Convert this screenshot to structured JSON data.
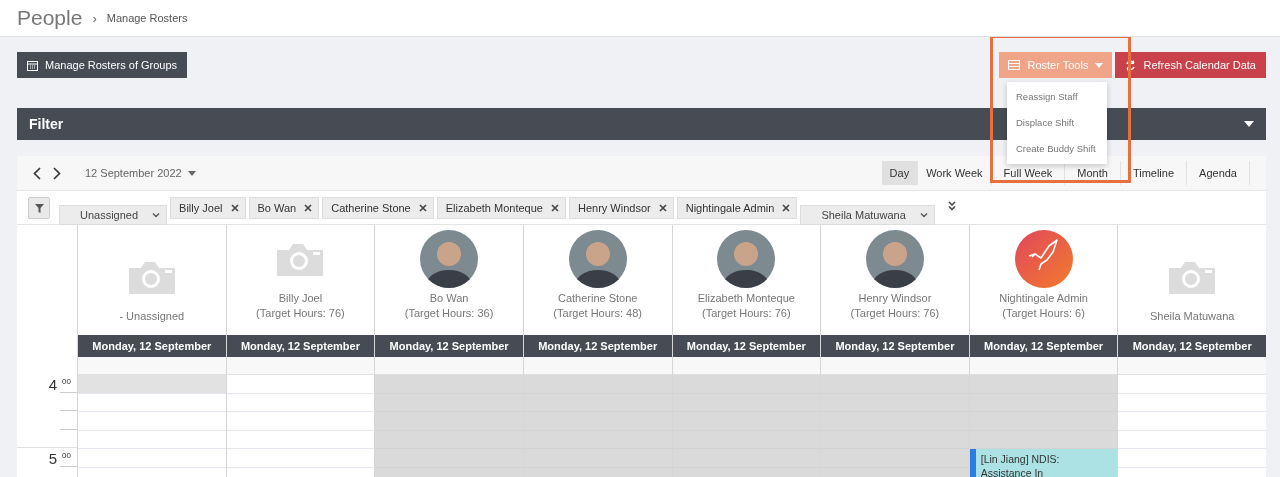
{
  "breadcrumb": {
    "title": "People",
    "separator": "›",
    "current": "Manage Rosters"
  },
  "buttons": [
    {
      "label": "Manage Rosters of Groups",
      "kind": "dark"
    },
    {
      "label": "Roster Tools",
      "kind": "tools",
      "expanded": true
    },
    {
      "label": "Refresh Calendar Data",
      "kind": "danger"
    }
  ],
  "roster_menu": [
    "Reassign Staff",
    "Displace Shift",
    "Create Buddy Shift"
  ],
  "filter": {
    "title": "Filter",
    "expanded": false
  },
  "calendar": {
    "date": "12 September 2022",
    "views": [
      {
        "label": "Day",
        "selected": true
      },
      {
        "label": "Work Week",
        "selected": false
      },
      {
        "label": "Full Week",
        "selected": false
      },
      {
        "label": "Month",
        "selected": false
      },
      {
        "label": "Timeline",
        "selected": false
      },
      {
        "label": "Agenda",
        "selected": false
      }
    ],
    "chips": [
      {
        "label": "Unassigned",
        "kind": "dropdown"
      },
      {
        "label": "Billy Joel",
        "kind": "removable"
      },
      {
        "label": "Bo Wan",
        "kind": "removable"
      },
      {
        "label": "Catherine Stone",
        "kind": "removable"
      },
      {
        "label": "Elizabeth Monteque",
        "kind": "removable"
      },
      {
        "label": "Henry Windsor",
        "kind": "removable"
      },
      {
        "label": "Nightingale Admin",
        "kind": "removable"
      },
      {
        "label": "Sheila Matuwana",
        "kind": "dropdown"
      }
    ],
    "hours": [
      {
        "hour": "4",
        "minutes": "00"
      },
      {
        "hour": "5",
        "minutes": "00"
      }
    ],
    "resources": [
      {
        "name": "- Unassigned",
        "kind": "camera",
        "day": "Monday, 12 September",
        "unavailable": false,
        "first_slot_shaded": true
      },
      {
        "name": "Billy Joel",
        "target": "(Target Hours: 76)",
        "kind": "camera",
        "day": "Monday, 12 September",
        "unavailable": false,
        "first_slot_shaded": false
      },
      {
        "name": "Bo Wan",
        "target": "(Target Hours: 36)",
        "kind": "person",
        "day": "Monday, 12 September",
        "unavailable": true,
        "first_slot_shaded": false
      },
      {
        "name": "Catherine Stone",
        "target": "(Target Hours: 48)",
        "kind": "person",
        "day": "Monday, 12 September",
        "unavailable": true,
        "first_slot_shaded": false
      },
      {
        "name": "Elizabeth Monteque",
        "target": "(Target Hours: 76)",
        "kind": "person",
        "day": "Monday, 12 September",
        "unavailable": true,
        "first_slot_shaded": false
      },
      {
        "name": "Henry Windsor",
        "target": "(Target Hours: 76)",
        "kind": "person",
        "day": "Monday, 12 September",
        "unavailable": true,
        "first_slot_shaded": false
      },
      {
        "name": "Nightingale Admin",
        "target": "(Target Hours: 6)",
        "kind": "logo",
        "day": "Monday, 12 September",
        "unavailable": true,
        "first_slot_shaded": false,
        "events": [
          {
            "text": "[Lin Jiang] NDIS: Assistance In"
          }
        ]
      },
      {
        "name": "Sheila Matuwana",
        "kind": "camera",
        "day": "Monday, 12 September",
        "unavailable": false,
        "first_slot_shaded": false
      }
    ]
  }
}
